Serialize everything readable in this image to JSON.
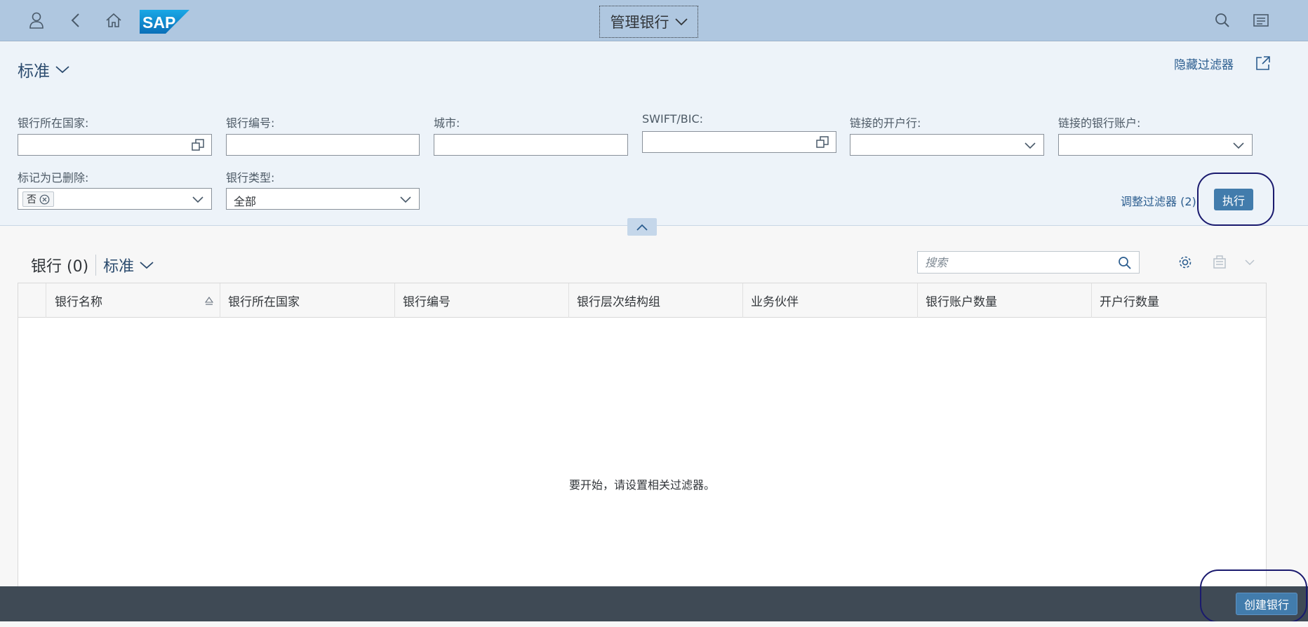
{
  "shell": {
    "app_title": "管理银行",
    "logo_text": "SAP",
    "icons": [
      "user-icon",
      "back-icon",
      "home-icon",
      "search-icon",
      "notifications-icon"
    ]
  },
  "filterbar": {
    "variant": "标准",
    "hide_filters": "隐藏过滤器",
    "adapt_filters": "调整过滤器 (2)",
    "go": "执行",
    "fields": [
      {
        "label": "银行所在国家:",
        "value": ""
      },
      {
        "label": "银行编号:",
        "value": ""
      },
      {
        "label": "城市:",
        "value": ""
      },
      {
        "label": "SWIFT/BIC:",
        "value": ""
      },
      {
        "label": "链接的开户行:",
        "value": ""
      },
      {
        "label": "链接的银行账户:",
        "value": ""
      },
      {
        "label": "标记为已删除:",
        "token": "否"
      },
      {
        "label": "银行类型:",
        "value": "全部"
      }
    ]
  },
  "table": {
    "title": "银行 (0)",
    "variant": "标准",
    "search_placeholder": "搜索",
    "columns": [
      "银行名称",
      "银行所在国家",
      "银行编号",
      "银行层次结构组",
      "业务伙伴",
      "银行账户数量",
      "开户行数量"
    ],
    "empty_message": "要开始，请设置相关过滤器。"
  },
  "footer": {
    "create_button": "创建银行"
  }
}
